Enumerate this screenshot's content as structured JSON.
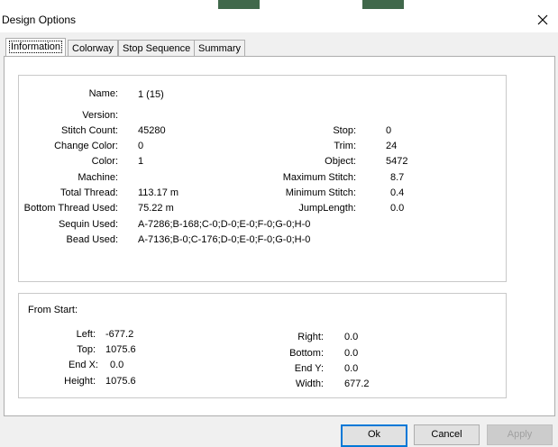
{
  "window": {
    "title": "Design Options"
  },
  "tabs": [
    {
      "label": "Information"
    },
    {
      "label": "Colorway"
    },
    {
      "label": "Stop Sequence"
    },
    {
      "label": "Summary"
    }
  ],
  "info": {
    "name_label": "Name:",
    "name_value": "1 (15)",
    "version_label": "Version:",
    "version_value": "",
    "stitch_count_label": "Stitch Count:",
    "stitch_count_value": "45280",
    "change_color_label": "Change Color:",
    "change_color_value": "0",
    "color_label": "Color:",
    "color_value": "1",
    "machine_label": "Machine:",
    "machine_value": "",
    "total_thread_label": "Total Thread:",
    "total_thread_value": "113.17 m",
    "bottom_thread_label": "Bottom Thread Used:",
    "bottom_thread_value": "75.22 m",
    "sequin_label": "Sequin Used:",
    "sequin_value": "A-7286;B-168;C-0;D-0;E-0;F-0;G-0;H-0",
    "bead_label": "Bead Used:",
    "bead_value": "A-7136;B-0;C-176;D-0;E-0;F-0;G-0;H-0",
    "stop_label": "Stop:",
    "stop_value": "0",
    "trim_label": "Trim:",
    "trim_value": "24",
    "object_label": "Object:",
    "object_value": "5472",
    "max_stitch_label": "Maximum Stitch:",
    "max_stitch_value": "8.7",
    "min_stitch_label": "Minimum Stitch:",
    "min_stitch_value": "0.4",
    "jump_label": "JumpLength:",
    "jump_value": "0.0"
  },
  "from_start": {
    "heading": "From Start:",
    "left_label": "Left:",
    "left_value": "-677.2",
    "top_label": "Top:",
    "top_value": "1075.6",
    "endx_label": "End X:",
    "endx_value": "0.0",
    "height_label": "Height:",
    "height_value": "1075.6",
    "right_label": "Right:",
    "right_value": "0.0",
    "bottom_label": "Bottom:",
    "bottom_value": "0.0",
    "endy_label": "End Y:",
    "endy_value": "0.0",
    "width_label": "Width:",
    "width_value": "677.2"
  },
  "buttons": {
    "ok": "Ok",
    "cancel": "Cancel",
    "apply": "Apply"
  }
}
